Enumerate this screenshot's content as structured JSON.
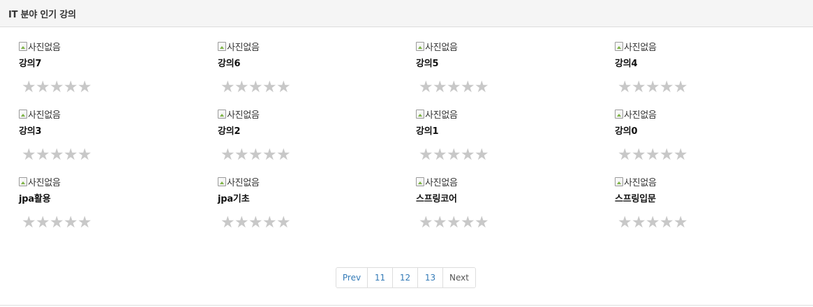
{
  "panel": {
    "title": "IT 분야 인기 강의"
  },
  "image_alt": "사진없음",
  "courses": [
    {
      "title": "강의7",
      "rating_stars": 0
    },
    {
      "title": "강의6",
      "rating_stars": 0
    },
    {
      "title": "강의5",
      "rating_stars": 0
    },
    {
      "title": "강의4",
      "rating_stars": 0
    },
    {
      "title": "강의3",
      "rating_stars": 0
    },
    {
      "title": "강의2",
      "rating_stars": 0
    },
    {
      "title": "강의1",
      "rating_stars": 0
    },
    {
      "title": "강의0",
      "rating_stars": 0
    },
    {
      "title": "jpa활용",
      "rating_stars": 0
    },
    {
      "title": "jpa기초",
      "rating_stars": 0
    },
    {
      "title": "스프링코어",
      "rating_stars": 0
    },
    {
      "title": "스프링입문",
      "rating_stars": 0
    }
  ],
  "star_glyph": "★",
  "pagination": {
    "prev_label": "Prev",
    "pages": [
      "11",
      "12",
      "13"
    ],
    "next_label": "Next"
  },
  "colors": {
    "header_bg": "#f5f5f5",
    "star_empty": "#c8c8c8",
    "link": "#337ab7"
  },
  "icons": {
    "image_placeholder": "broken-image-icon",
    "rating": "star-icon"
  }
}
